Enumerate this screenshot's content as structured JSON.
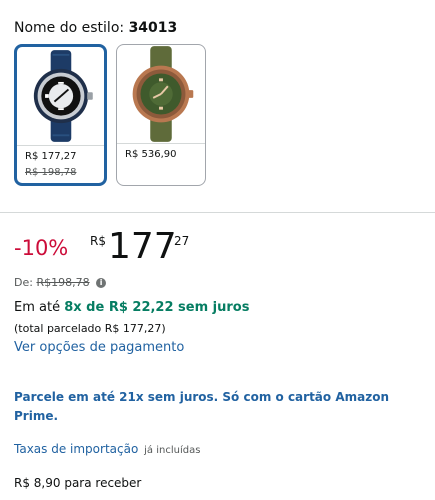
{
  "style": {
    "label": "Nome do estilo: ",
    "value": "34013"
  },
  "variants": [
    {
      "price": "R$ 177,27",
      "old_price": "R$ 198,78",
      "selected": true,
      "image_icon": "blue-watch-image"
    },
    {
      "price": "R$ 536,90",
      "old_price": "",
      "selected": false,
      "image_icon": "green-bronze-watch-image"
    }
  ],
  "price_block": {
    "discount": "-10%",
    "currency": "R$",
    "whole": "177",
    "cents": "27",
    "list_price_label": "De: ",
    "list_price": "R$198,78",
    "info_icon": "i"
  },
  "installments": {
    "prefix": "Em até ",
    "offer": "8x de R$ 22,22 sem juros",
    "total": "(total parcelado R$ 177,27)",
    "payment_link": "Ver opções de pagamento"
  },
  "prime_promo": "Parcele em até 21x sem juros. Só com o cartão Amazon Prime.",
  "tax": {
    "link": "Taxas de importação",
    "note": "já incluídas"
  },
  "shipping": "R$ 8,90 para receber",
  "colors": {
    "discount": "#cc0c39",
    "link": "#2162a1",
    "green": "#067d62",
    "selected_border": "#2162a1"
  }
}
